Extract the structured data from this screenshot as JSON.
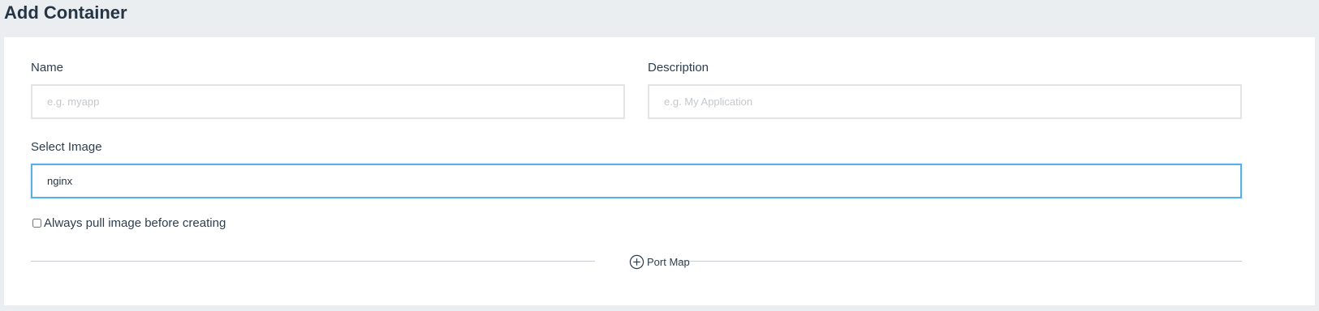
{
  "page": {
    "title": "Add Container"
  },
  "form": {
    "name": {
      "label": "Name",
      "placeholder": "e.g. myapp",
      "value": ""
    },
    "description": {
      "label": "Description",
      "placeholder": "e.g. My Application",
      "value": ""
    },
    "image": {
      "label": "Select Image",
      "value": "nginx"
    },
    "always_pull": {
      "label": "Always pull image before creating",
      "checked": false
    },
    "port_map": {
      "label": "Port Map",
      "icon": "plus-circle-icon"
    }
  },
  "colors": {
    "background": "#ebeef0",
    "panel": "#ffffff",
    "text": "#2c3e50",
    "focus_border": "#5aaee8",
    "input_border": "#e2e5e8"
  }
}
